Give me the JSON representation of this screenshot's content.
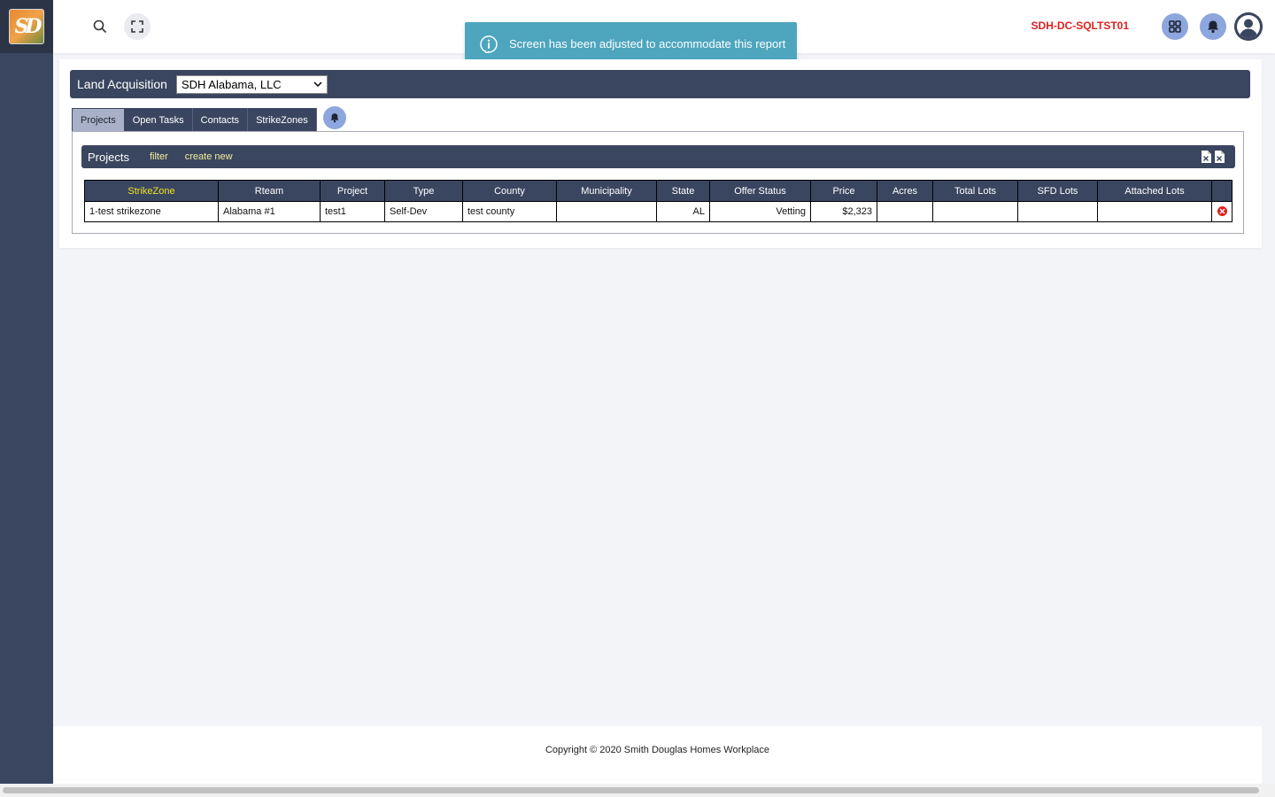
{
  "colors": {
    "sidebar": "#3a4660",
    "accent": "#8da6dd",
    "toast": "#4ea5be",
    "server": "#e02020",
    "filter_link": "#f2ee9a",
    "strikezone_header": "#f0e020"
  },
  "logo": {
    "text": "SD"
  },
  "topbar": {
    "search_icon": "search-icon",
    "fullscreen_icon": "fullscreen-icon",
    "server_name": "SDH-DC-SQLTST01",
    "apps_icon": "grid-icon",
    "bell_icon": "bell-icon",
    "user_icon": "user-avatar-icon"
  },
  "toast": {
    "icon": "info-icon",
    "message": "Screen has been adjusted to accommodate this report"
  },
  "header": {
    "title": "Land Acquisition",
    "company_select": "SDH Alabama, LLC"
  },
  "tabs": [
    {
      "label": "Projects",
      "active": true
    },
    {
      "label": "Open Tasks",
      "active": false
    },
    {
      "label": "Contacts",
      "active": false
    },
    {
      "label": "StrikeZones",
      "active": false
    }
  ],
  "panel": {
    "title": "Projects",
    "filter_label": "filter",
    "create_label": "create new",
    "export_icons": [
      "excel-export-icon",
      "excel-export-icon"
    ]
  },
  "table": {
    "columns": [
      "StrikeZone",
      "Rteam",
      "Project",
      "Type",
      "County",
      "Municipality",
      "State",
      "Offer Status",
      "Price",
      "Acres",
      "Total Lots",
      "SFD Lots",
      "Attached Lots",
      ""
    ],
    "rows": [
      [
        "1-test strikezone",
        "Alabama #1",
        "test1",
        "Self-Dev",
        "test county",
        "",
        "AL",
        "Vetting",
        "$2,323",
        "",
        "",
        "",
        "",
        ""
      ]
    ]
  },
  "footer": {
    "text": "Copyright © 2020 Smith Douglas Homes Workplace"
  }
}
